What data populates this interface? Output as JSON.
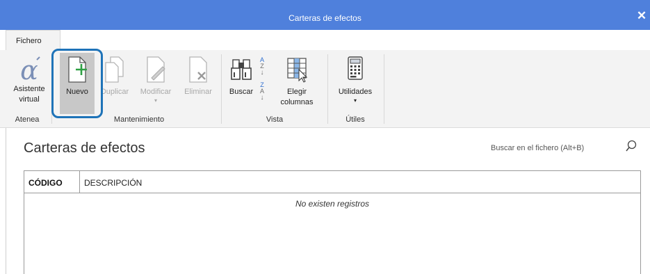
{
  "window": {
    "title": "Carteras de efectos",
    "close_label": "✕"
  },
  "tabs": [
    {
      "label": "Fichero"
    }
  ],
  "ribbon": {
    "groups": {
      "atenea": "Atenea",
      "mantenimiento": "Mantenimiento",
      "vista": "Vista",
      "utiles": "Útiles"
    },
    "buttons": {
      "asistente_line1": "Asistente",
      "asistente_line2": "virtual",
      "nuevo": "Nuevo",
      "duplicar": "Duplicar",
      "modificar": "Modificar",
      "eliminar": "Eliminar",
      "buscar": "Buscar",
      "elegir_line1": "Elegir",
      "elegir_line2": "columnas",
      "utilidades": "Utilidades"
    },
    "sort_asc": "A\nZ",
    "sort_desc": "Z\nA"
  },
  "main": {
    "title": "Carteras de efectos",
    "search_placeholder": "Buscar en el fichero (Alt+B)"
  },
  "table": {
    "columns": [
      "CÓDIGO",
      "DESCRIPCIÓN"
    ],
    "empty_message": "No existen registros"
  },
  "colors": {
    "titlebar": "#4f80dc",
    "highlight": "#1e73b8",
    "add_green": "#2ea043"
  }
}
